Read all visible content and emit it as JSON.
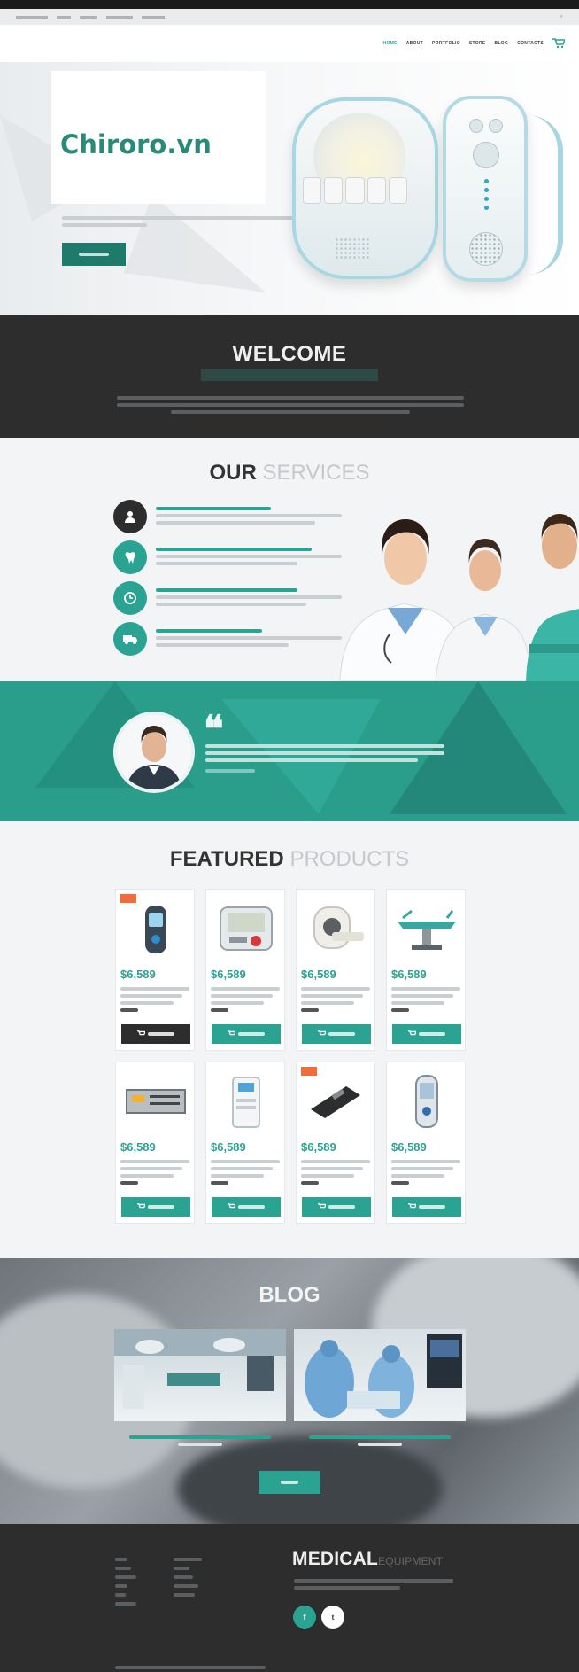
{
  "brand": {
    "watermark": "Chiroro.vn"
  },
  "nav": {
    "items": [
      "HOME",
      "ABOUT",
      "PORTFOLIO",
      "STORE",
      "BLOG",
      "CONTACTS"
    ],
    "active_index": 0
  },
  "sections": {
    "welcome_title": "WELCOME",
    "services_title_bold": "OUR",
    "services_title_light": "SERVICES",
    "products_title_bold": "FEATURED",
    "products_title_light": "PRODUCTS",
    "blog_title": "BLOG",
    "footer_logo_bold": "MEDICAL",
    "footer_logo_light": "EQUIPMENT"
  },
  "products": [
    {
      "price": "$6,589",
      "icon": "glucose-meter-icon",
      "sale": true,
      "button_style": "dark"
    },
    {
      "price": "$6,589",
      "icon": "blood-pressure-monitor-icon",
      "sale": false,
      "button_style": "teal"
    },
    {
      "price": "$6,589",
      "icon": "mri-scanner-icon",
      "sale": false,
      "button_style": "teal"
    },
    {
      "price": "$6,589",
      "icon": "operating-table-icon",
      "sale": false,
      "button_style": "teal"
    },
    {
      "price": "$6,589",
      "icon": "lab-analyzer-icon",
      "sale": false,
      "button_style": "teal"
    },
    {
      "price": "$6,589",
      "icon": "diagnostic-machine-icon",
      "sale": false,
      "button_style": "teal"
    },
    {
      "price": "$6,589",
      "icon": "handheld-scanner-icon",
      "sale": true,
      "button_style": "teal"
    },
    {
      "price": "$6,589",
      "icon": "glucometer-icon",
      "sale": false,
      "button_style": "teal"
    }
  ],
  "colors": {
    "accent": "#2aa393",
    "dark": "#2d2d2d",
    "brand_text": "#2a8a78",
    "sale": "#f26b3a"
  }
}
